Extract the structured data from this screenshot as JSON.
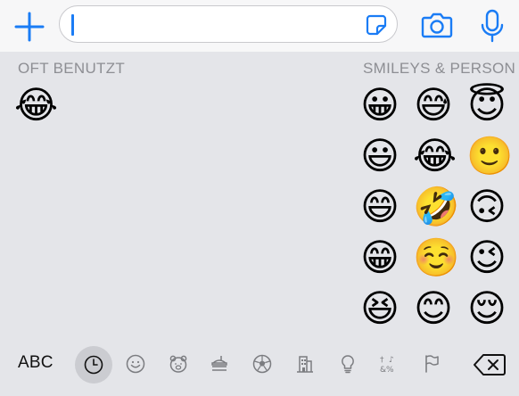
{
  "input": {
    "value": ""
  },
  "sections": {
    "frequent": {
      "title": "OFT BENUTZT",
      "emojis": [
        "😂"
      ]
    },
    "smileys": {
      "title": "SMILEYS & PERSON",
      "emojis": [
        "😀",
        "😅",
        "😇",
        "😃",
        "😂",
        "🙂",
        "😄",
        "🤣",
        "🙃",
        "😁",
        "☺️",
        "😉",
        "😆",
        "😊",
        "😌"
      ]
    }
  },
  "bottom": {
    "abc_label": "ABC",
    "categories": [
      "clock-icon",
      "smiley-icon",
      "bear-icon",
      "food-icon",
      "ball-icon",
      "building-icon",
      "bulb-icon",
      "symbols-icon",
      "flag-icon"
    ],
    "active_category": "clock-icon"
  },
  "colors": {
    "accent": "#1a7cf5",
    "keyboard_bg": "#e4e5e9",
    "section_text": "#8d8e93"
  }
}
